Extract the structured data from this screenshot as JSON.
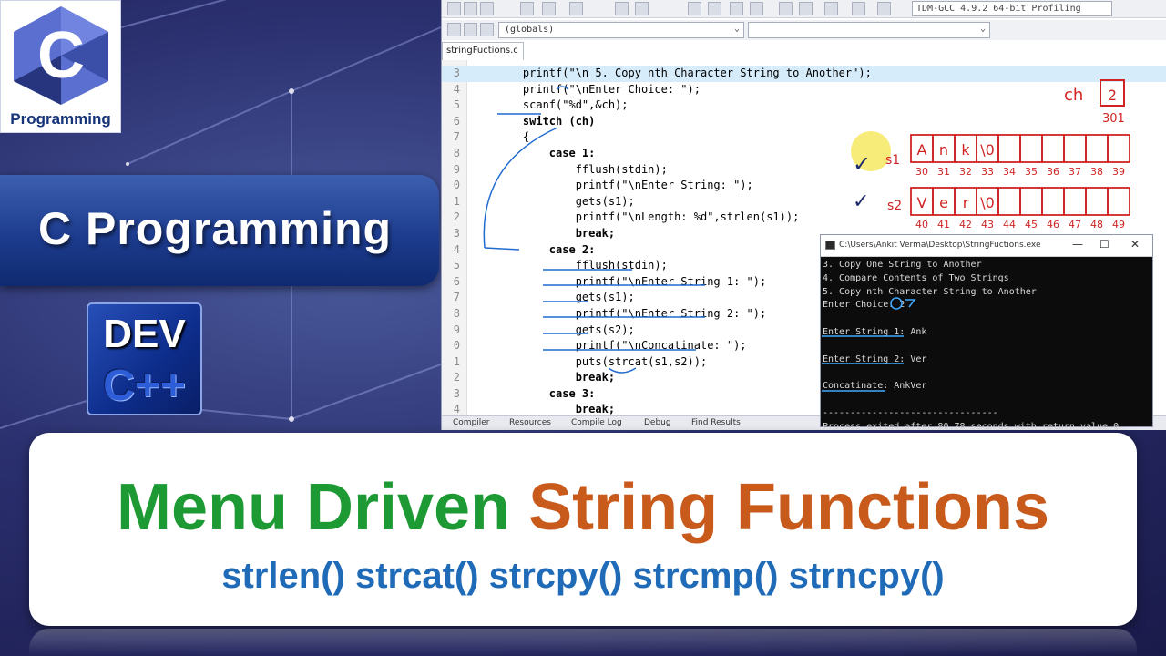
{
  "logo": {
    "letter": "C",
    "label": "Programming"
  },
  "banner": {
    "text": "C Programming"
  },
  "dev_logo": {
    "top": "DEV",
    "bottom": "C++"
  },
  "ide": {
    "compiler": "TDM-GCC 4.9.2 64-bit Profiling",
    "scope_combo": "(globals)",
    "file_tab": "stringFuctions.c",
    "code_lines": [
      {
        "ln": "3",
        "text": "    printf(\"\\n 5. Copy nth Character String to Another\");"
      },
      {
        "ln": "4",
        "text": "    printf(\"\\nEnter Choice: \");"
      },
      {
        "ln": "5",
        "text": "    scanf(\"%d\",&ch);"
      },
      {
        "ln": "6",
        "text": "    switch (ch)"
      },
      {
        "ln": "7",
        "text": "    {"
      },
      {
        "ln": "8",
        "text": "        case 1:"
      },
      {
        "ln": "9",
        "text": "            fflush(stdin);"
      },
      {
        "ln": "0",
        "text": "            printf(\"\\nEnter String: \");"
      },
      {
        "ln": "1",
        "text": "            gets(s1);"
      },
      {
        "ln": "2",
        "text": "            printf(\"\\nLength: %d\",strlen(s1));"
      },
      {
        "ln": "3",
        "text": "            break;"
      },
      {
        "ln": "4",
        "text": "        case 2:"
      },
      {
        "ln": "5",
        "text": "            fflush(stdin);"
      },
      {
        "ln": "6",
        "text": "            printf(\"\\nEnter String 1: \");"
      },
      {
        "ln": "7",
        "text": "            gets(s1);"
      },
      {
        "ln": "8",
        "text": "            printf(\"\\nEnter String 2: \");"
      },
      {
        "ln": "9",
        "text": "            gets(s2);"
      },
      {
        "ln": "0",
        "text": "            printf(\"\\nConcatinate: \");"
      },
      {
        "ln": "1",
        "text": "            puts(strcat(s1,s2));"
      },
      {
        "ln": "2",
        "text": "            break;"
      },
      {
        "ln": "3",
        "text": "        case 3:"
      },
      {
        "ln": "4",
        "text": "            break;"
      }
    ],
    "bottom_tabs": [
      "Compiler",
      "Resources",
      "Compile Log",
      "Debug",
      "Find Results"
    ]
  },
  "annotations": {
    "ch_label": "ch",
    "ch_value": "2",
    "ch_addr": "301",
    "s1_label": "s1",
    "s1_chars": [
      "A",
      "n",
      "k",
      "\\0",
      "",
      "",
      "",
      "",
      "",
      ""
    ],
    "s1_addrs": [
      "30",
      "31",
      "32",
      "33",
      "34",
      "35",
      "36",
      "37",
      "38",
      "39"
    ],
    "s2_label": "s2",
    "s2_chars": [
      "V",
      "e",
      "r",
      "\\0",
      "",
      "",
      "",
      "",
      "",
      ""
    ],
    "s2_addrs": [
      "40",
      "41",
      "42",
      "43",
      "44",
      "45",
      "46",
      "47",
      "48",
      "49"
    ]
  },
  "console": {
    "title": "C:\\Users\\Ankit Verma\\Desktop\\StringFuctions.exe",
    "lines": [
      "3. Copy One String to Another",
      "4. Compare Contents of Two Strings",
      "5. Copy nth Character String to Another",
      "Enter Choice: 2",
      "",
      "Enter String 1: Ank",
      "",
      "Enter String 2: Ver",
      "",
      "Concatinate: AnkVer",
      "",
      "--------------------------------",
      "Process exited after 80.78 seconds with return value 0"
    ]
  },
  "title_card": {
    "word1": "Menu Driven",
    "word2": "String Functions",
    "subtitle": "strlen() strcat() strcpy() strcmp() strncpy()"
  },
  "colors": {
    "green": "#1e9a34",
    "orange": "#c85a1c",
    "blue": "#1f6bb8",
    "banner": "#1d3c8e"
  }
}
